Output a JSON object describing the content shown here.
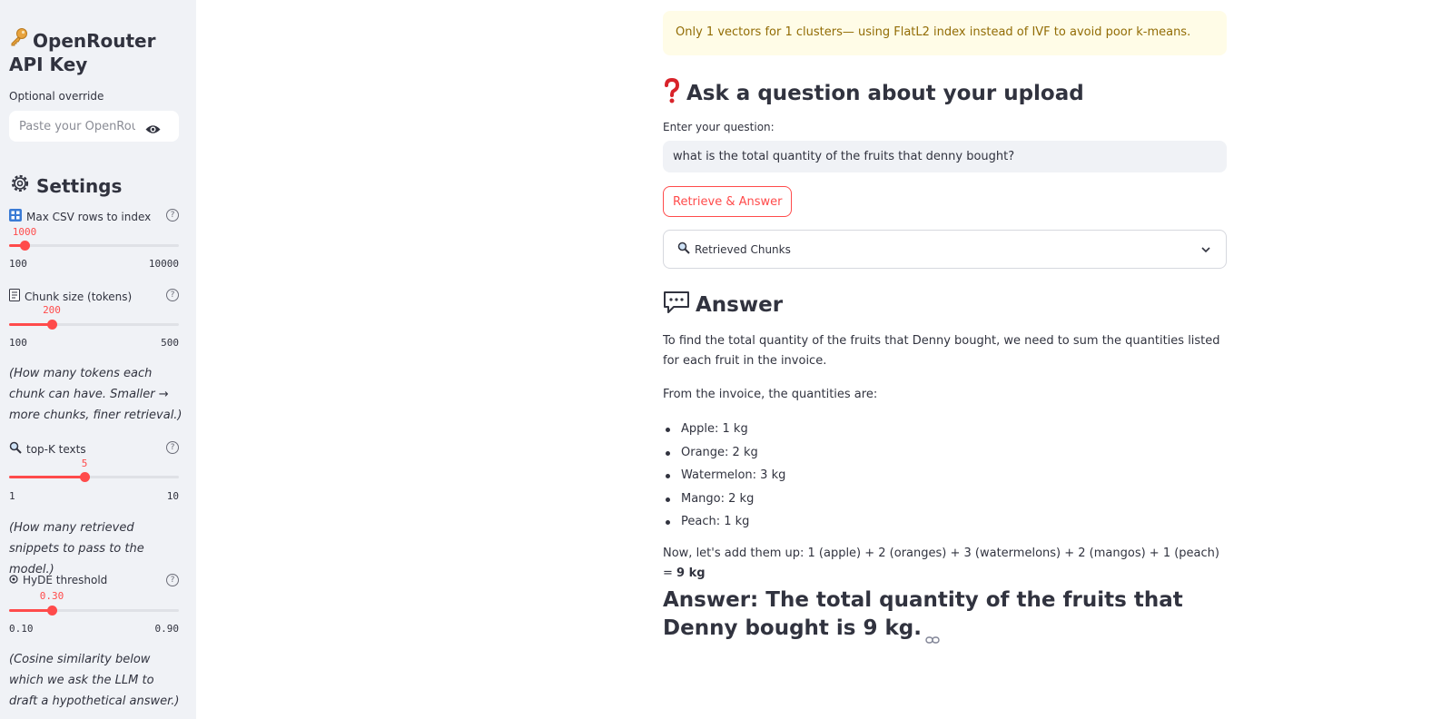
{
  "sidebar": {
    "api_key_title": "OpenRouter API Key",
    "api_key_icon": "key-icon",
    "override_label": "Optional override",
    "api_key_placeholder": "Paste your OpenRouter API key",
    "settings_title": "Settings",
    "settings_icon": "gear-icon",
    "sliders": [
      {
        "icon": "grid-icon",
        "label": "Max CSV rows to index",
        "value": "1000",
        "min": "100",
        "max": "10000",
        "level": 0.09
      },
      {
        "icon": "document-icon",
        "label": "Chunk size (tokens)",
        "value": "200",
        "min": "100",
        "max": "500",
        "level": 0.25
      },
      {
        "icon": "magnifier-icon",
        "label": "top-K texts",
        "value": "5",
        "min": "1",
        "max": "10",
        "level": 0.444
      },
      {
        "icon": "hyde-icon",
        "label": "HyDE threshold",
        "value": "0.30",
        "min": "0.10",
        "max": "0.90",
        "level": 0.25
      }
    ],
    "notes": {
      "chunk": "(How many tokens each chunk can have. Smaller → more chunks, finer retrieval.)",
      "topk": "(How many retrieved snippets to pass to the model.)",
      "hyde": "(Cosine similarity below which we ask the LLM to draft a hypothetical answer.)"
    }
  },
  "main": {
    "alert": "Only 1 vectors for 1 clusters— using FlatL2 index instead of IVF to avoid poor k-means.",
    "ask_title": "Ask a question about your upload",
    "question_label": "Enter your question:",
    "question_value": "what is the total quantity of the fruits that denny bought?",
    "button_label": "Retrieve & Answer",
    "expander_label": "Retrieved Chunks",
    "answer_title": "Answer",
    "answer_intro": "To find the total quantity of the fruits that Denny bought, we need to sum the quantities listed for each fruit in the invoice.",
    "answer_from": "From the invoice, the quantities are:",
    "items": [
      "Apple: 1 kg",
      "Orange: 2 kg",
      "Watermelon: 3 kg",
      "Mango: 2 kg",
      "Peach: 1 kg"
    ],
    "sum_text": "Now, let's add them up: 1 (apple) + 2 (oranges) + 3 (watermelons) + 2 (mangos) + 1 (peach) = ",
    "sum_result": "9 kg",
    "final_answer": "Answer: The total quantity of the fruits that Denny bought is 9 kg."
  },
  "colors": {
    "accent": "#ff4b4b",
    "sidebar_bg": "#f0f2f6",
    "alert_bg": "#fffce7",
    "alert_text": "#926c05",
    "text": "#31333f"
  }
}
